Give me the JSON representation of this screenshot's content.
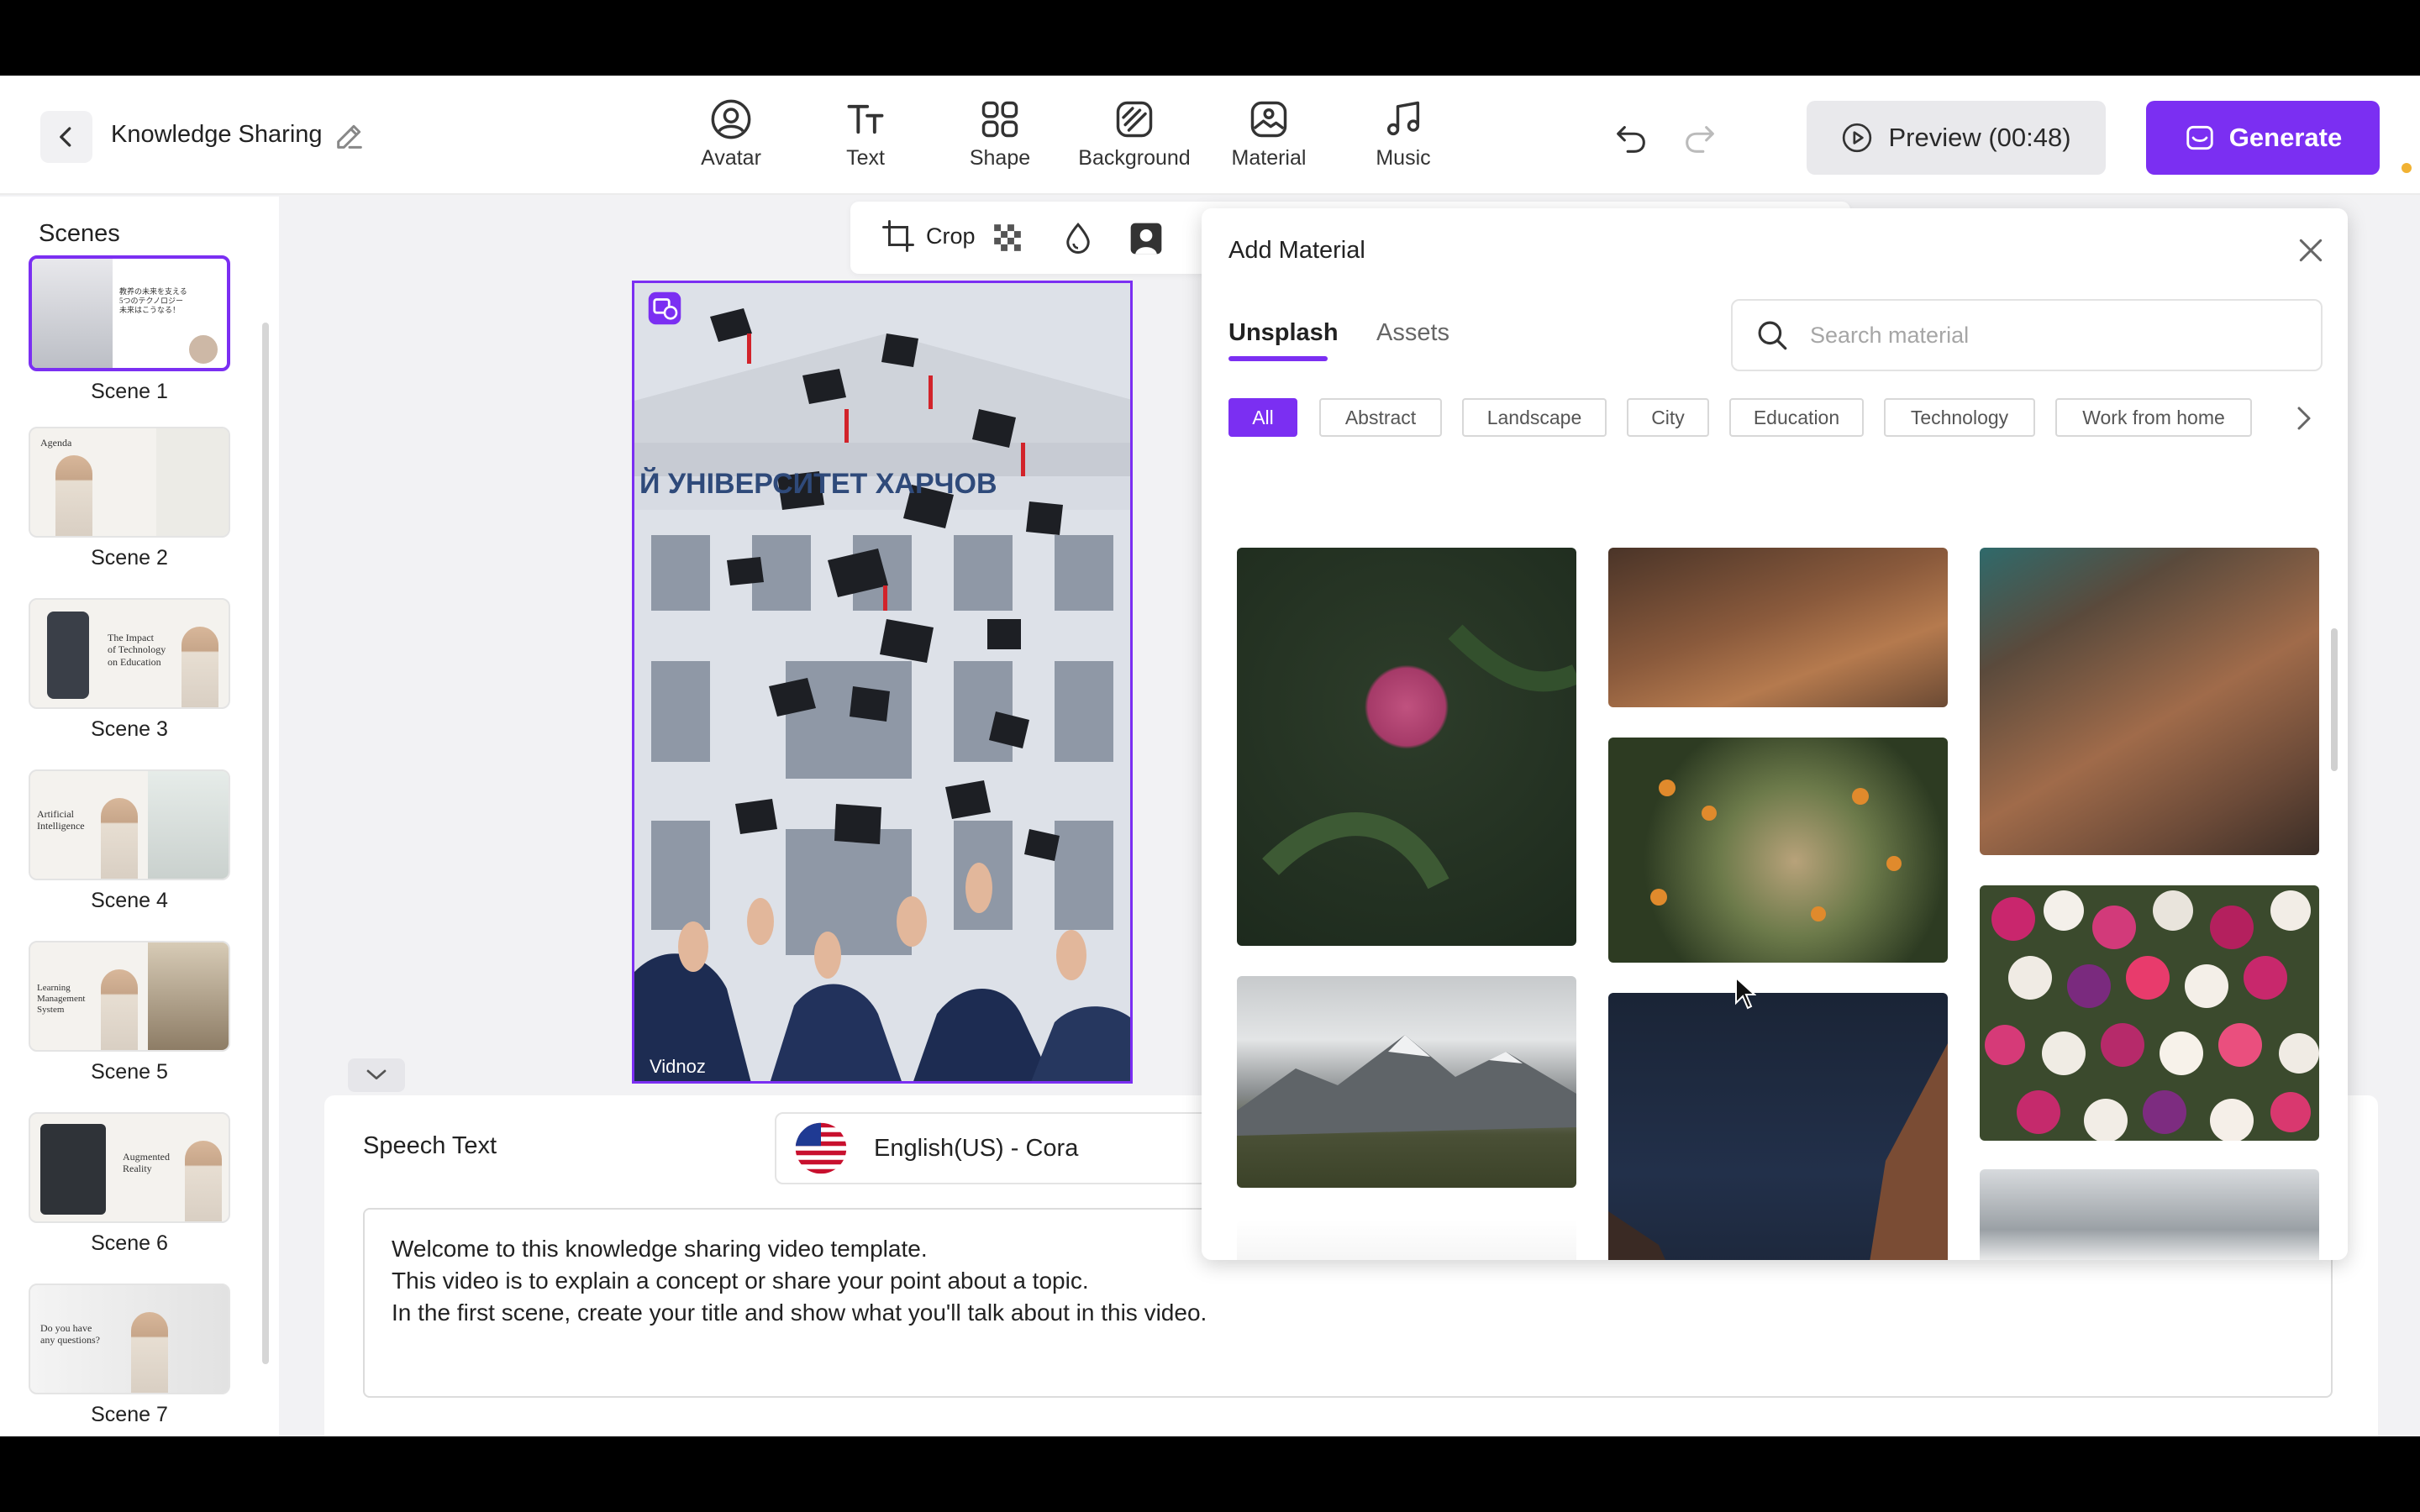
{
  "header": {
    "back_label": "Back",
    "project_title": "Knowledge Sharing",
    "tools": [
      {
        "label": "Avatar",
        "icon": "avatar-icon"
      },
      {
        "label": "Text",
        "icon": "text-icon"
      },
      {
        "label": "Shape",
        "icon": "shape-icon"
      },
      {
        "label": "Background",
        "icon": "background-icon"
      },
      {
        "label": "Material",
        "icon": "material-icon"
      },
      {
        "label": "Music",
        "icon": "music-icon"
      }
    ],
    "preview_label": "Preview (00:48)",
    "generate_label": "Generate"
  },
  "sidebar": {
    "title": "Scenes",
    "scenes": [
      {
        "label": "Scene 1",
        "thumb_text": "教养の未来を支える\n5つのテクノロジー\n未来はこうなる！",
        "active": true
      },
      {
        "label": "Scene 2",
        "thumb_text": "Agenda"
      },
      {
        "label": "Scene 3",
        "thumb_text": "The Impact\nof Technology\non Education"
      },
      {
        "label": "Scene 4",
        "thumb_text": "Artificial\nIntelligence"
      },
      {
        "label": "Scene 5",
        "thumb_text": "Learning\nManagement\nSystem"
      },
      {
        "label": "Scene 6",
        "thumb_text": "Augmented\nReality"
      },
      {
        "label": "Scene 7",
        "thumb_text": "Do you have\nany questions?"
      }
    ]
  },
  "image_toolbar": {
    "crop_label": "Crop"
  },
  "canvas": {
    "watermark": "Vidnoz",
    "building_sign": "Й УНІВЕРСИТЕТ ХАРЧОВ"
  },
  "speech": {
    "label": "Speech Text",
    "voice": "English(US) - Cora",
    "lines": [
      "Welcome to this knowledge sharing video template.",
      "This video is to explain a concept or share your point about a topic.",
      "In the first scene, create your title and show what you'll talk about in this video."
    ]
  },
  "material_modal": {
    "title": "Add Material",
    "tabs": [
      "Unsplash",
      "Assets"
    ],
    "active_tab": "Unsplash",
    "search_placeholder": "Search material",
    "categories": [
      "All",
      "Abstract",
      "Landscape",
      "City",
      "Education",
      "Technology",
      "Work from home"
    ],
    "active_category": "All"
  },
  "colors": {
    "accent": "#7b2ff2",
    "toolbar_bg": "#ffffff",
    "workspace_bg": "#f2f2f4"
  }
}
